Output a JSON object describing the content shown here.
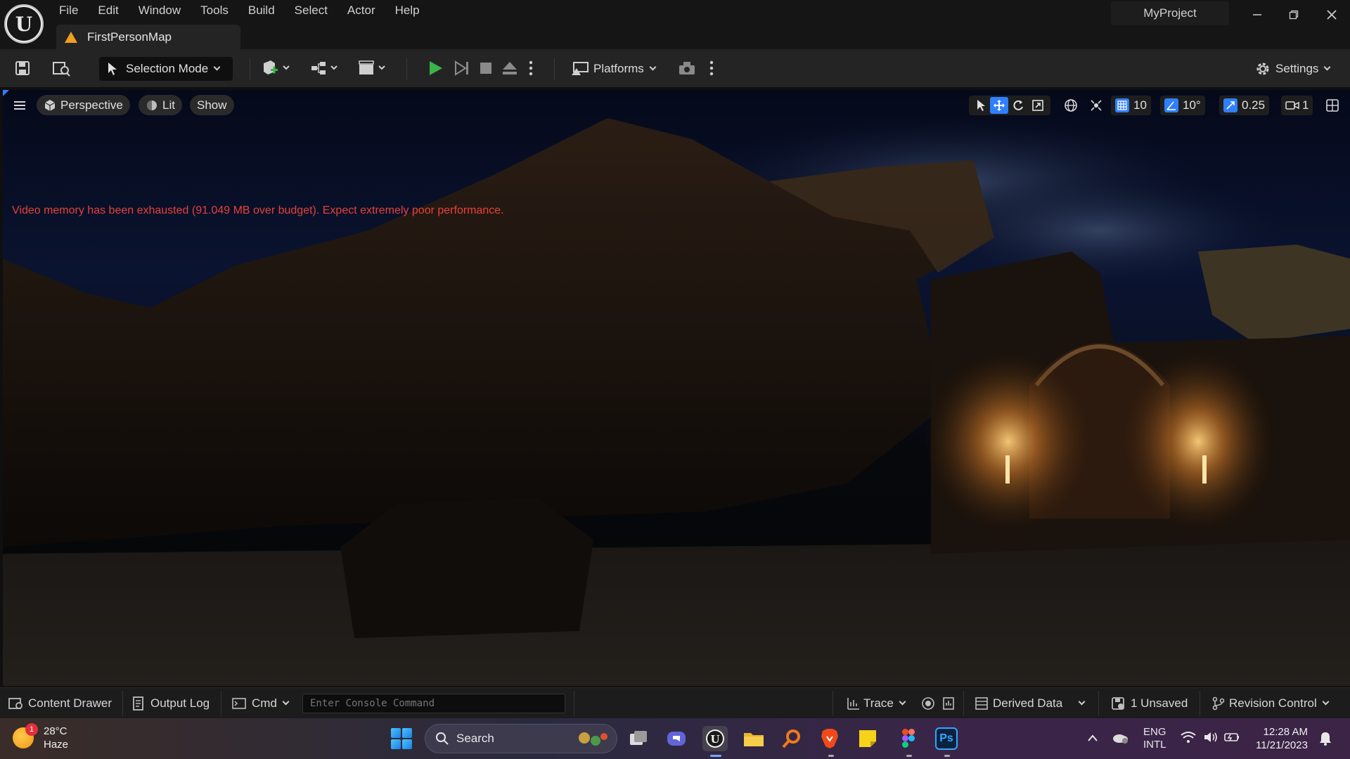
{
  "menu": [
    "File",
    "Edit",
    "Window",
    "Tools",
    "Build",
    "Select",
    "Actor",
    "Help"
  ],
  "document_tab": "FirstPersonMap",
  "project_name": "MyProject",
  "toolbar": {
    "selection_mode": "Selection Mode",
    "platforms": "Platforms",
    "settings": "Settings"
  },
  "viewport": {
    "perspective": "Perspective",
    "lit": "Lit",
    "show": "Show",
    "grid_snap": "10",
    "rotation_snap": "10°",
    "scale_snap": "0.25",
    "camera_speed": "1",
    "warning": "Video memory has been exhausted (91.049 MB over budget). Expect extremely poor performance."
  },
  "statusbar": {
    "content_drawer": "Content Drawer",
    "output_log": "Output Log",
    "cmd": "Cmd",
    "console_placeholder": "Enter Console Command",
    "trace": "Trace",
    "derived_data": "Derived Data",
    "unsaved": "1 Unsaved",
    "revision_control": "Revision Control"
  },
  "taskbar": {
    "weather_temp": "28°C",
    "weather_desc": "Haze",
    "weather_badge": "1",
    "search": "Search",
    "language_1": "ENG",
    "language_2": "INTL",
    "time": "12:28 AM",
    "date": "11/21/2023",
    "ps_label": "Ps"
  },
  "colors": {
    "warning_text": "#e8403a",
    "accent": "#2f7fff",
    "play": "#39b54a"
  }
}
